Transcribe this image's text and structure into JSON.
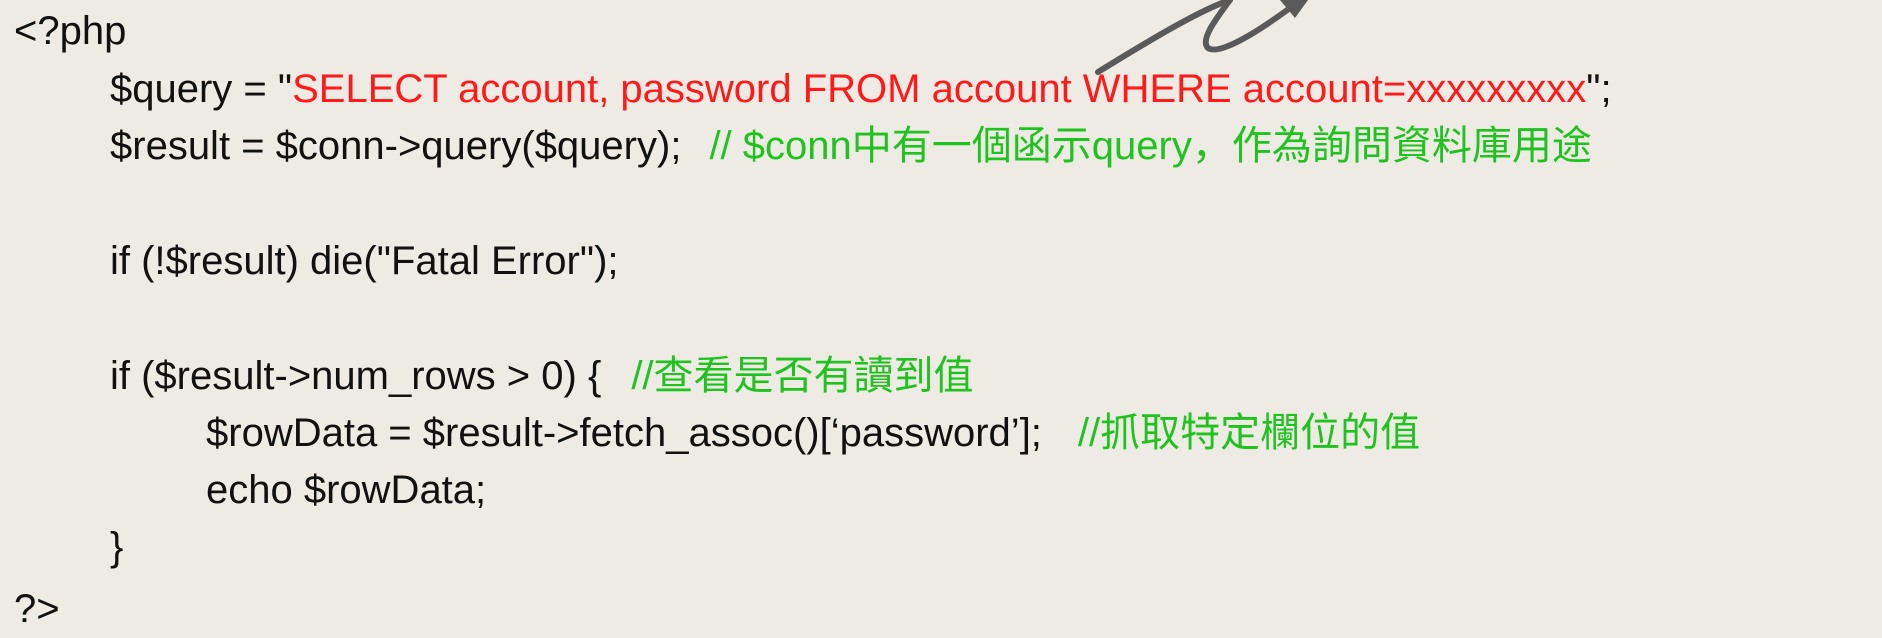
{
  "code": {
    "open_tag": "<?php",
    "line1": {
      "prefix": "$query = \"",
      "sql": "SELECT account, password FROM account WHERE account=xxxxxxxxx",
      "suffix": "\";"
    },
    "line2": {
      "code": "$result = $conn->query($query);",
      "comment": "// $conn中有一個函示query，作為詢問資料庫用途"
    },
    "line3": {
      "code": "if (!$result) die(\"Fatal Error\");"
    },
    "line4": {
      "code": "if ($result->num_rows > 0) {",
      "comment": "//查看是否有讀到值"
    },
    "line5": {
      "code": "$rowData = $result->fetch_assoc()[‘password’];",
      "comment": "//抓取特定欄位的值"
    },
    "line6": {
      "code": "echo $rowData;"
    },
    "line7": {
      "code": "}"
    },
    "close_tag": "?>"
  },
  "colors": {
    "background": "#eeebe4",
    "code_text": "#111111",
    "sql_string": "#ff1a1a",
    "comment": "#1fc21f",
    "arrow": "#5a5a5a"
  },
  "icons": {
    "arrow": "curved-arrow-icon"
  }
}
